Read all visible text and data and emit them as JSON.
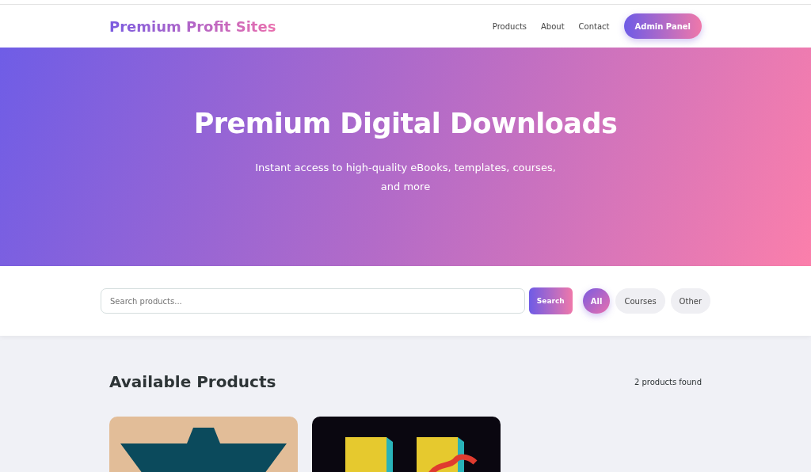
{
  "nav": {
    "logo": "Premium Profit Sites",
    "links": [
      "Products",
      "About",
      "Contact"
    ],
    "admin_button": "Admin Panel"
  },
  "hero": {
    "title": "Premium Digital Downloads",
    "subtitle": "Instant access to high-quality eBooks, templates, courses, and more"
  },
  "search": {
    "placeholder": "Search products...",
    "button": "Search"
  },
  "filters": [
    {
      "label": "All",
      "selected": true
    },
    {
      "label": "Courses",
      "selected": false
    },
    {
      "label": "Other",
      "selected": false
    }
  ],
  "products_section": {
    "title": "Available Products",
    "count": "2 products found"
  },
  "products": [
    {
      "kind": "star"
    },
    {
      "kind": "blocks"
    }
  ]
}
